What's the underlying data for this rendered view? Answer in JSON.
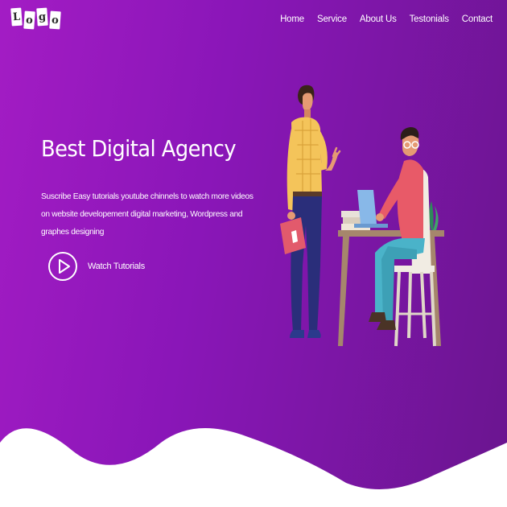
{
  "header": {
    "logo_letters": [
      "L",
      "o",
      "g",
      "o"
    ],
    "nav": [
      "Home",
      "Service",
      "About Us",
      "Testonials",
      "Contact"
    ]
  },
  "hero": {
    "title": "Best Digital Agency",
    "description": "Suscribe Easy tutorials youtube chinnels to watch more videos on website developement digital marketing, Wordpress and graphes designing",
    "watch_label": "Watch Tutorials"
  },
  "colors": {
    "gradient_start": "#a31cc4",
    "gradient_end": "#6a158f",
    "text": "#ffffff",
    "wave": "#ffffff"
  },
  "icons": [
    "play-icon",
    "team-illustration"
  ]
}
